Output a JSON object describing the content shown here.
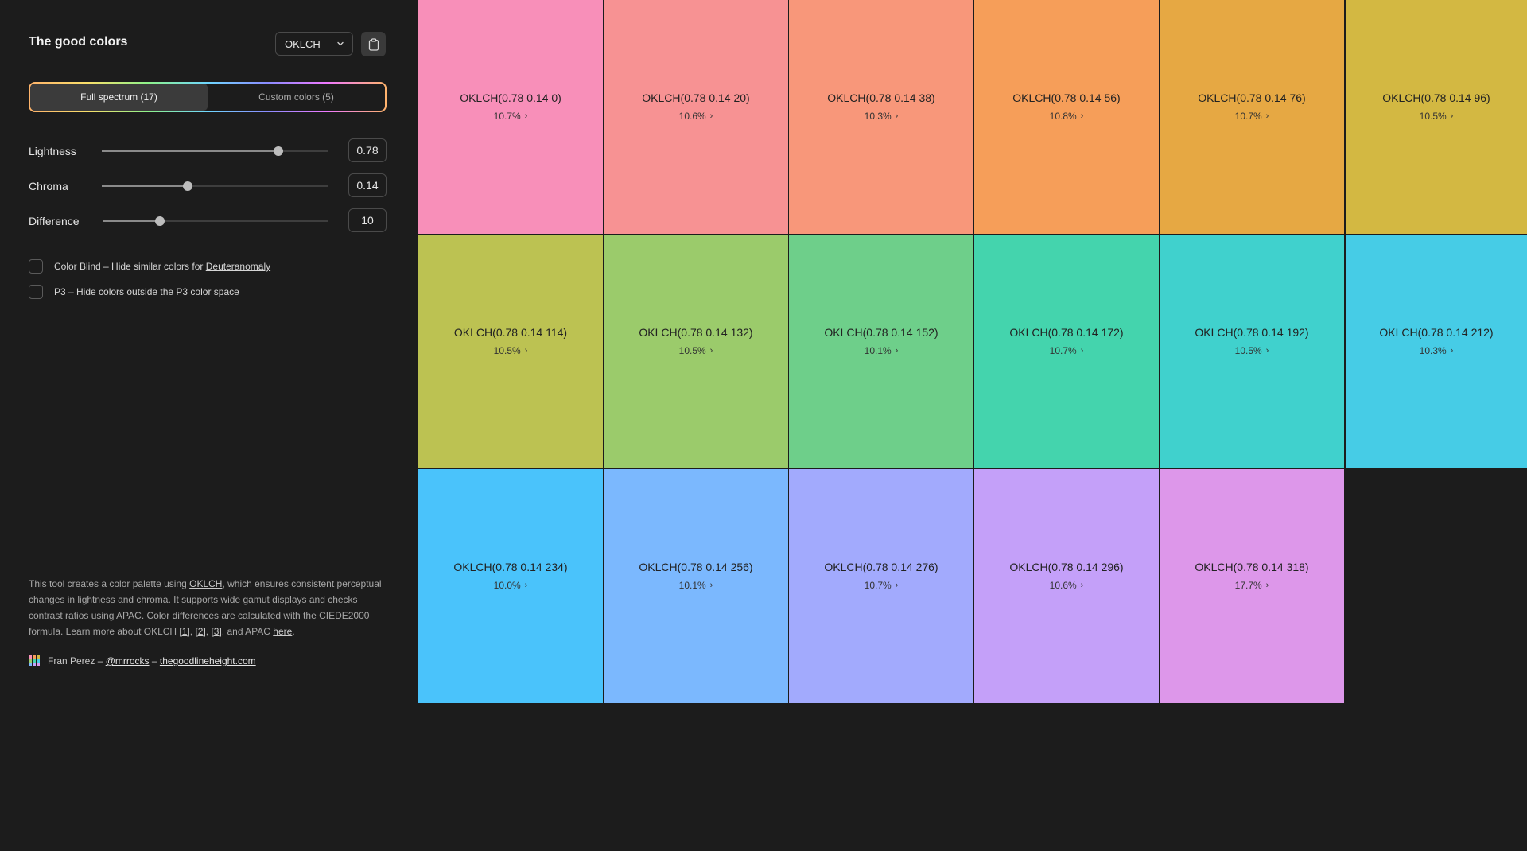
{
  "app": {
    "title": "The good colors"
  },
  "format": {
    "selected": "OKLCH"
  },
  "tabs": [
    {
      "label": "Full spectrum (17)",
      "active": true
    },
    {
      "label": "Custom colors (5)",
      "active": false
    }
  ],
  "sliders": [
    {
      "label": "Lightness",
      "value": "0.78",
      "fraction": 0.78
    },
    {
      "label": "Chroma",
      "value": "0.14",
      "fraction": 0.38
    },
    {
      "label": "Difference",
      "value": "10",
      "fraction": 0.25
    }
  ],
  "options": {
    "colorblind": {
      "prefix": "Color Blind – Hide similar colors for ",
      "link": "Deuteranomaly",
      "checked": false
    },
    "p3": {
      "label": "P3 – Hide colors outside the P3 color space",
      "checked": false
    }
  },
  "about": {
    "t1": "This tool creates a color palette using ",
    "l1": "OKLCH",
    "t2": ", which ensures consistent perceptual changes in lightness and chroma. It supports wide gamut displays and checks contrast ratios using APAC. Color differences are calculated with the CIEDE2000 formula. Learn more about OKLCH ",
    "r1": "[1]",
    "c1": ", ",
    "r2": "[2]",
    "c2": ", ",
    "r3": "[3]",
    "t3": ", and APAC ",
    "here": "here",
    "end": "."
  },
  "credits": {
    "author": "Fran Perez – ",
    "handle": "@mrrocks",
    "sep": " – ",
    "site": "thegoodlineheight.com"
  },
  "swatches": [
    {
      "label": "OKLCH(0.78 0.14 0)",
      "percent": "10.7%",
      "color": "#f88fb9"
    },
    {
      "label": "OKLCH(0.78 0.14 20)",
      "percent": "10.6%",
      "color": "#f79293"
    },
    {
      "label": "OKLCH(0.78 0.14 38)",
      "percent": "10.3%",
      "color": "#f8977a"
    },
    {
      "label": "OKLCH(0.78 0.14 56)",
      "percent": "10.8%",
      "color": "#f69e59"
    },
    {
      "label": "OKLCH(0.78 0.14 76)",
      "percent": "10.7%",
      "color": "#e6a843"
    },
    {
      "label": "OKLCH(0.78 0.14 96)",
      "percent": "10.5%",
      "color": "#d3b842"
    },
    {
      "label": "OKLCH(0.78 0.14 114)",
      "percent": "10.5%",
      "color": "#bcc252"
    },
    {
      "label": "OKLCH(0.78 0.14 132)",
      "percent": "10.5%",
      "color": "#9bcb6b"
    },
    {
      "label": "OKLCH(0.78 0.14 152)",
      "percent": "10.1%",
      "color": "#6ecf8a"
    },
    {
      "label": "OKLCH(0.78 0.14 172)",
      "percent": "10.7%",
      "color": "#44d4ad"
    },
    {
      "label": "OKLCH(0.78 0.14 192)",
      "percent": "10.5%",
      "color": "#40d1cd"
    },
    {
      "label": "OKLCH(0.78 0.14 212)",
      "percent": "10.3%",
      "color": "#46cce6"
    },
    {
      "label": "OKLCH(0.78 0.14 234)",
      "percent": "10.0%",
      "color": "#4ac3fb"
    },
    {
      "label": "OKLCH(0.78 0.14 256)",
      "percent": "10.1%",
      "color": "#7bb8fe"
    },
    {
      "label": "OKLCH(0.78 0.14 276)",
      "percent": "10.7%",
      "color": "#a2aafd"
    },
    {
      "label": "OKLCH(0.78 0.14 296)",
      "percent": "10.6%",
      "color": "#c4a0f9"
    },
    {
      "label": "OKLCH(0.78 0.14 318)",
      "percent": "17.7%",
      "color": "#dd97ea"
    }
  ]
}
